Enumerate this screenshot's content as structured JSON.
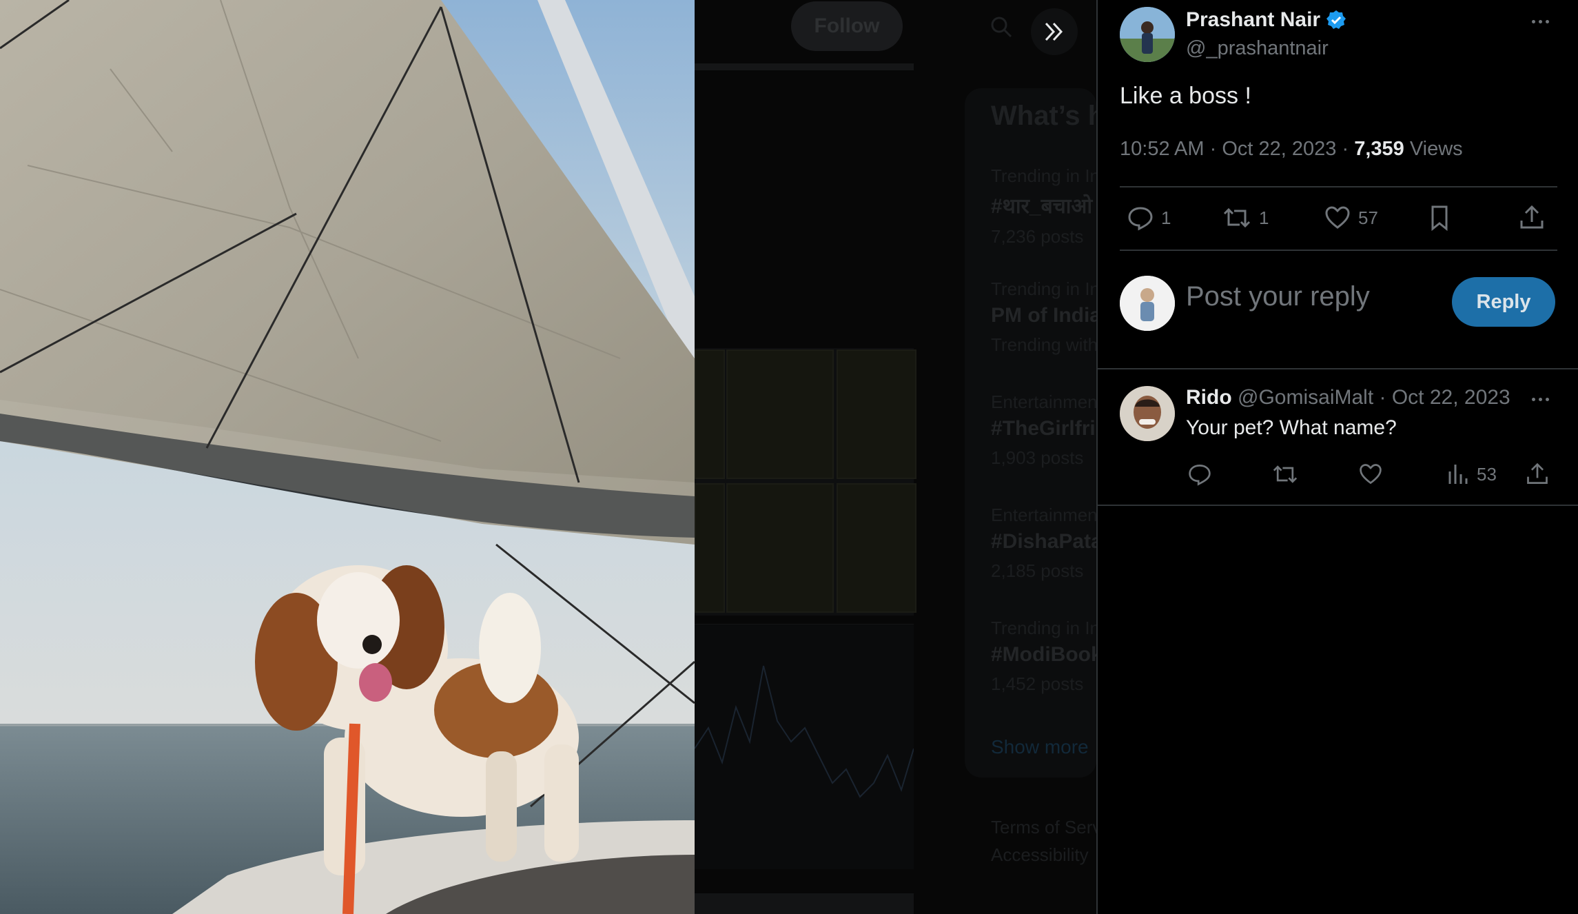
{
  "colors": {
    "background": "#000000",
    "text_primary": "#e7e9ea",
    "text_secondary": "#71767b",
    "divider": "#2f3336",
    "accent_blue": "#1d9bf0",
    "reply_button": "#1d6fa8"
  },
  "photo": {
    "subject": "shih-tzu dog with red leash standing on sailboat deck under a white sail, sea and sky in background"
  },
  "background_page": {
    "follow_label": "Follow",
    "trends_title": "What’s h",
    "trends": [
      {
        "context": "Trending in In",
        "tag": "#थार_बचाओ",
        "count": "7,236 posts"
      },
      {
        "context": "Trending in In",
        "tag": "PM of India",
        "count": "Trending with"
      },
      {
        "context": "Entertainment",
        "tag": "#TheGirlfri",
        "count": "1,903 posts"
      },
      {
        "context": "Entertainment",
        "tag": "#DishaPata",
        "count": "2,185 posts"
      },
      {
        "context": "Trending in In",
        "tag": "#ModiBook",
        "count": "1,452 posts"
      }
    ],
    "show_more": "Show more",
    "footer": [
      "Terms of Serv",
      "Accessibility"
    ]
  },
  "post": {
    "author_name": "Prashant Nair",
    "verified": true,
    "author_handle": "@_prashantnair",
    "text": "Like a boss !",
    "time": "10:52 AM",
    "date": "Oct 22, 2023",
    "views_count": "7,359",
    "views_label": "Views",
    "separator": "·",
    "actions": {
      "replies": "1",
      "reposts": "1",
      "likes": "57"
    }
  },
  "composer": {
    "placeholder": "Post your reply",
    "button_label": "Reply"
  },
  "replies": [
    {
      "name": "Rido",
      "handle": "@GomisaiMalt",
      "date": "Oct 22, 2023",
      "text": "Your pet? What name?",
      "views": "53"
    }
  ]
}
